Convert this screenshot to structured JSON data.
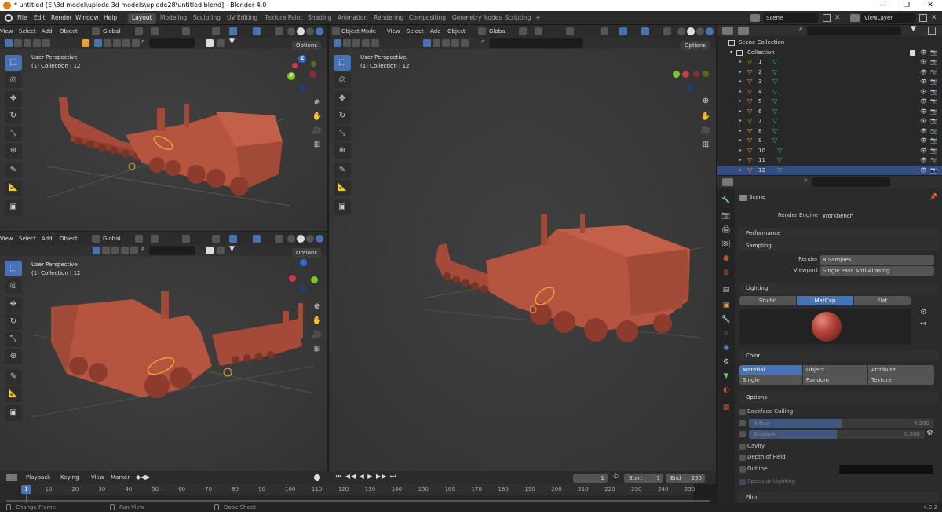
{
  "window": {
    "title": "* untitled [E:\\3d model\\uplode 3d models\\uplode28\\untitled.blend] - Blender 4.0",
    "minimize": "—",
    "maximize": "❐",
    "close": "✕"
  },
  "menu": [
    "File",
    "Edit",
    "Render",
    "Window",
    "Help"
  ],
  "workspaces": [
    "Layout",
    "Modeling",
    "Sculpting",
    "UV Editing",
    "Texture Paint",
    "Shading",
    "Animation",
    "Rendering",
    "Compositing",
    "Geometry Nodes",
    "Scripting"
  ],
  "workspace_add": "+",
  "scene_field": "Scene",
  "viewlayer_field": "ViewLayer",
  "viewports": {
    "top_left": {
      "menu": [
        "View",
        "Select",
        "Add",
        "Object"
      ],
      "orientation": "Global",
      "label1": "User Perspective",
      "label2": "(1) Collection | 12",
      "options": "Options"
    },
    "bottom_left": {
      "menu": [
        "View",
        "Select",
        "Add",
        "Object"
      ],
      "orientation": "Global",
      "label1": "User Perspective",
      "label2": "(1) Collection | 12",
      "options": "Options"
    },
    "right": {
      "mode": "Object Mode",
      "menu": [
        "View",
        "Select",
        "Add",
        "Object"
      ],
      "orientation": "Global",
      "label1": "User Perspective",
      "label2": "(1) Collection | 12",
      "options": "Options"
    }
  },
  "gizmo": {
    "z": "Z",
    "y": "Y",
    "x": "X"
  },
  "outliner": {
    "scene_collection": "Scene Collection",
    "collection": "Collection",
    "items": [
      "1",
      "2",
      "3",
      "4",
      "5",
      "6",
      "7",
      "8",
      "9",
      "10",
      "11",
      "12"
    ],
    "selected": "12"
  },
  "properties": {
    "context": "Scene",
    "render_engine_label": "Render Engine",
    "render_engine": "Workbench",
    "performance": "Performance",
    "sampling": "Sampling",
    "render_label": "Render",
    "render_samples": "8 Samples",
    "viewport_label": "Viewport",
    "viewport_aa": "Single Pass Anti-Aliasing",
    "lighting": "Lighting",
    "lighting_modes": [
      "Studio",
      "MatCap",
      "Flat"
    ],
    "lighting_active": "MatCap",
    "color": "Color",
    "color_modes": [
      "Material",
      "Object",
      "Attribute",
      "Single",
      "Random",
      "Texture"
    ],
    "color_active": "Material",
    "options": "Options",
    "backface_culling": "Backface Culling",
    "xray": "X-Ray",
    "xray_val": "0.500",
    "shadow": "Shadow",
    "shadow_val": "0.500",
    "cavity": "Cavity",
    "depth_of_field": "Depth of Field",
    "outline": "Outline",
    "specular": "Specular Lighting",
    "film": "Film"
  },
  "timeline": {
    "menu": [
      "Playback",
      "Keying",
      "View",
      "Marker"
    ],
    "current_frame": "1",
    "start_label": "Start",
    "start": "1",
    "end_label": "End",
    "end": "250",
    "ticks": [
      "1",
      "10",
      "20",
      "30",
      "40",
      "50",
      "60",
      "70",
      "80",
      "90",
      "100",
      "110",
      "120",
      "130",
      "140",
      "150",
      "160",
      "170",
      "180",
      "190",
      "200",
      "210",
      "220",
      "230",
      "240",
      "250"
    ]
  },
  "statusbar": {
    "left": "Change Frame",
    "mid": "Pan View",
    "right": "Dope Sheet",
    "version": "4.0.2"
  },
  "colors": {
    "accent": "#4772b3",
    "model": "#b5543f",
    "selection": "#e8a23c"
  }
}
